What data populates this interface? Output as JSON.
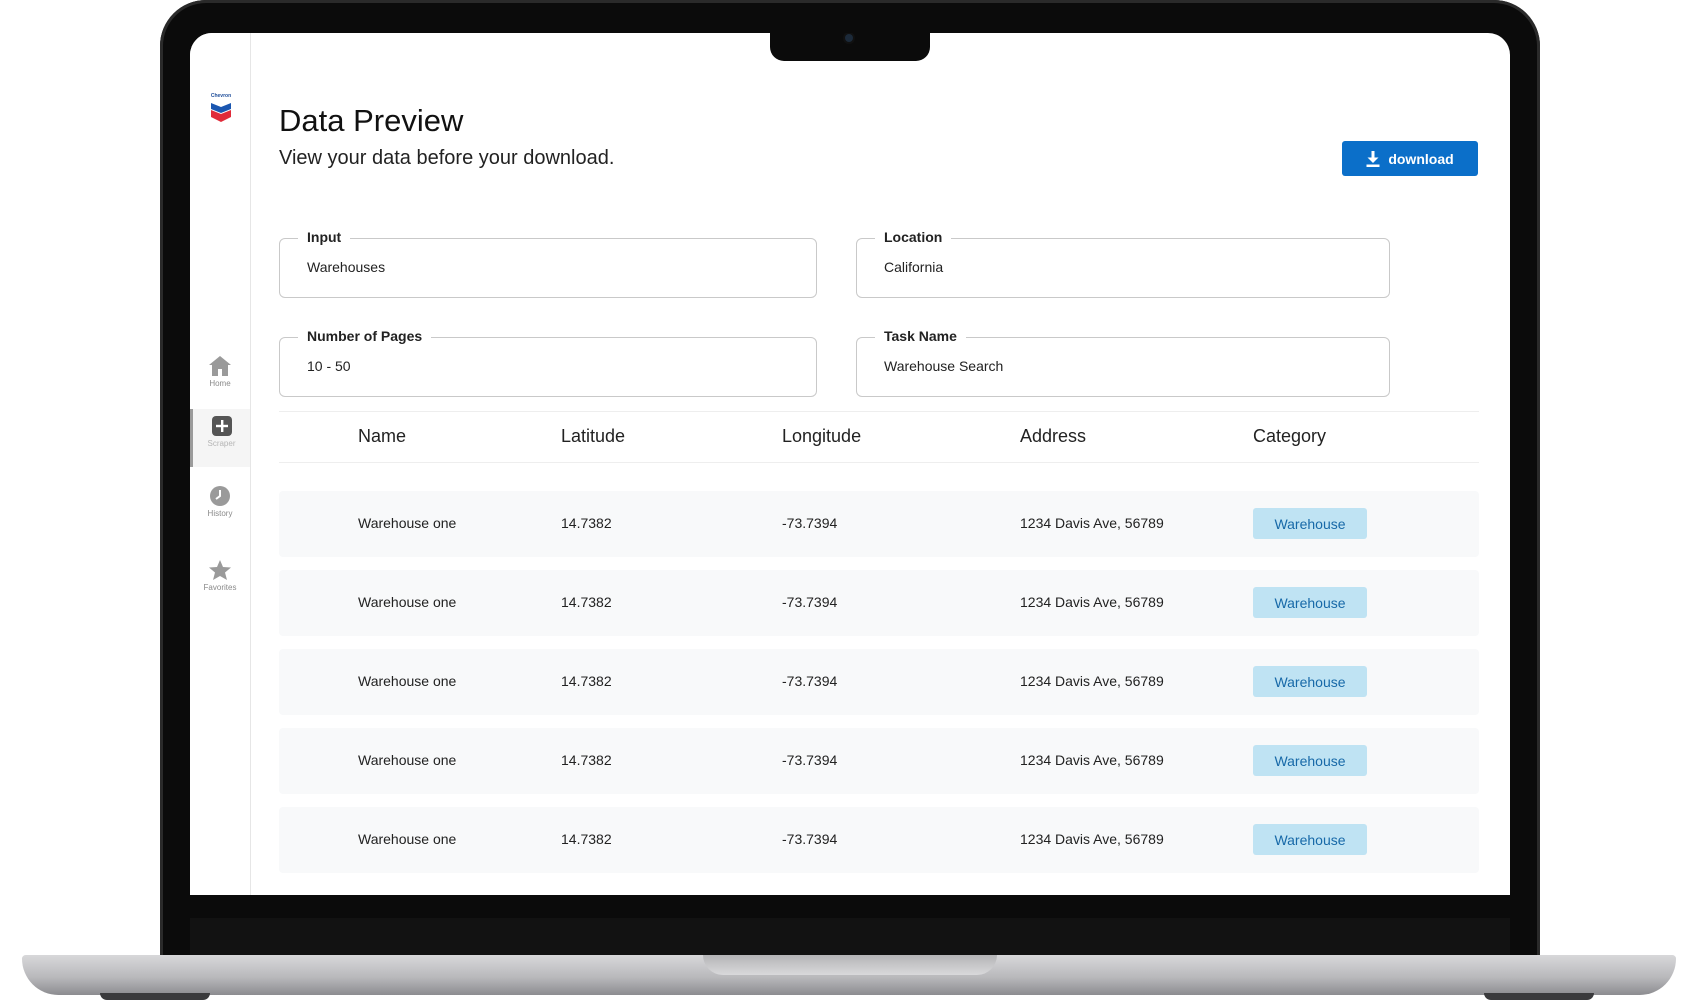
{
  "brand": {
    "logo_text": "Chevron"
  },
  "sidebar": {
    "items": [
      {
        "label": "Home",
        "icon": "home-icon"
      },
      {
        "label": "Scraper",
        "icon": "plus-square-icon"
      },
      {
        "label": "History",
        "icon": "clock-icon"
      },
      {
        "label": "Favorites",
        "icon": "star-icon"
      }
    ]
  },
  "header": {
    "title": "Data Preview",
    "subtitle": "View your data before your download.",
    "download_label": "download"
  },
  "form": {
    "input": {
      "label": "Input",
      "value": "Warehouses"
    },
    "location": {
      "label": "Location",
      "value": "California"
    },
    "pages": {
      "label": "Number of Pages",
      "value": "10 - 50"
    },
    "task": {
      "label": "Task Name",
      "value": "Warehouse Search"
    }
  },
  "table": {
    "columns": [
      "Name",
      "Latitude",
      "Longitude",
      "Address",
      "Category"
    ],
    "rows": [
      {
        "name": "Warehouse one",
        "lat": "14.7382",
        "lng": "-73.7394",
        "address": "1234 Davis Ave, 56789",
        "category": "Warehouse"
      },
      {
        "name": "Warehouse one",
        "lat": "14.7382",
        "lng": "-73.7394",
        "address": "1234 Davis Ave, 56789",
        "category": "Warehouse"
      },
      {
        "name": "Warehouse one",
        "lat": "14.7382",
        "lng": "-73.7394",
        "address": "1234 Davis Ave, 56789",
        "category": "Warehouse"
      },
      {
        "name": "Warehouse one",
        "lat": "14.7382",
        "lng": "-73.7394",
        "address": "1234 Davis Ave, 56789",
        "category": "Warehouse"
      },
      {
        "name": "Warehouse one",
        "lat": "14.7382",
        "lng": "-73.7394",
        "address": "1234 Davis Ave, 56789",
        "category": "Warehouse"
      }
    ]
  },
  "colors": {
    "accent": "#0b6fc9",
    "badge_bg": "#bfe3f3",
    "badge_text": "#1769a8",
    "row_bg": "#f8f9fa"
  }
}
